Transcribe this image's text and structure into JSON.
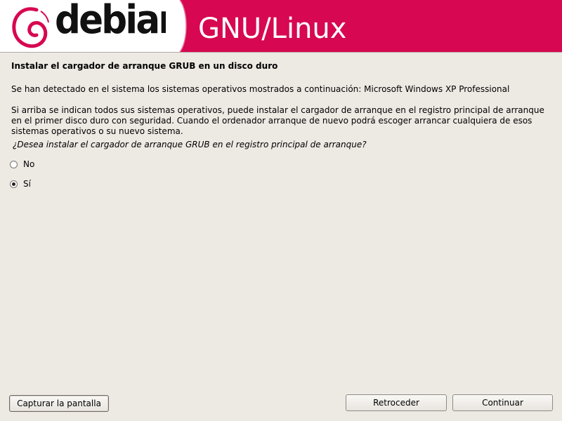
{
  "banner": {
    "logo_text": "debian",
    "product_text": "GNU/Linux"
  },
  "page": {
    "heading": "Instalar el cargador de arranque GRUB en un disco duro",
    "detected_text": "Se han detectado en el sistema los sistemas operativos mostrados a continuación: Microsoft Windows XP Professional",
    "explanation_text": "Si arriba se indican todos sus sistemas operativos, puede instalar el cargador de arranque en el registro principal de arranque en el primer disco duro con seguridad. Cuando el ordenador arranque de nuevo podrá escoger arrancar cualquiera de esos sistemas operativos o su nuevo sistema.",
    "question": "¿Desea instalar el cargador de arranque GRUB en el registro principal de arranque?"
  },
  "options": [
    {
      "label": "No",
      "selected": false
    },
    {
      "label": "Sí",
      "selected": true
    }
  ],
  "buttons": {
    "screenshot": "Capturar la pantalla",
    "back": "Retroceder",
    "continue": "Continuar"
  },
  "colors": {
    "banner_red": "#d70751",
    "background": "#ede9e3"
  }
}
